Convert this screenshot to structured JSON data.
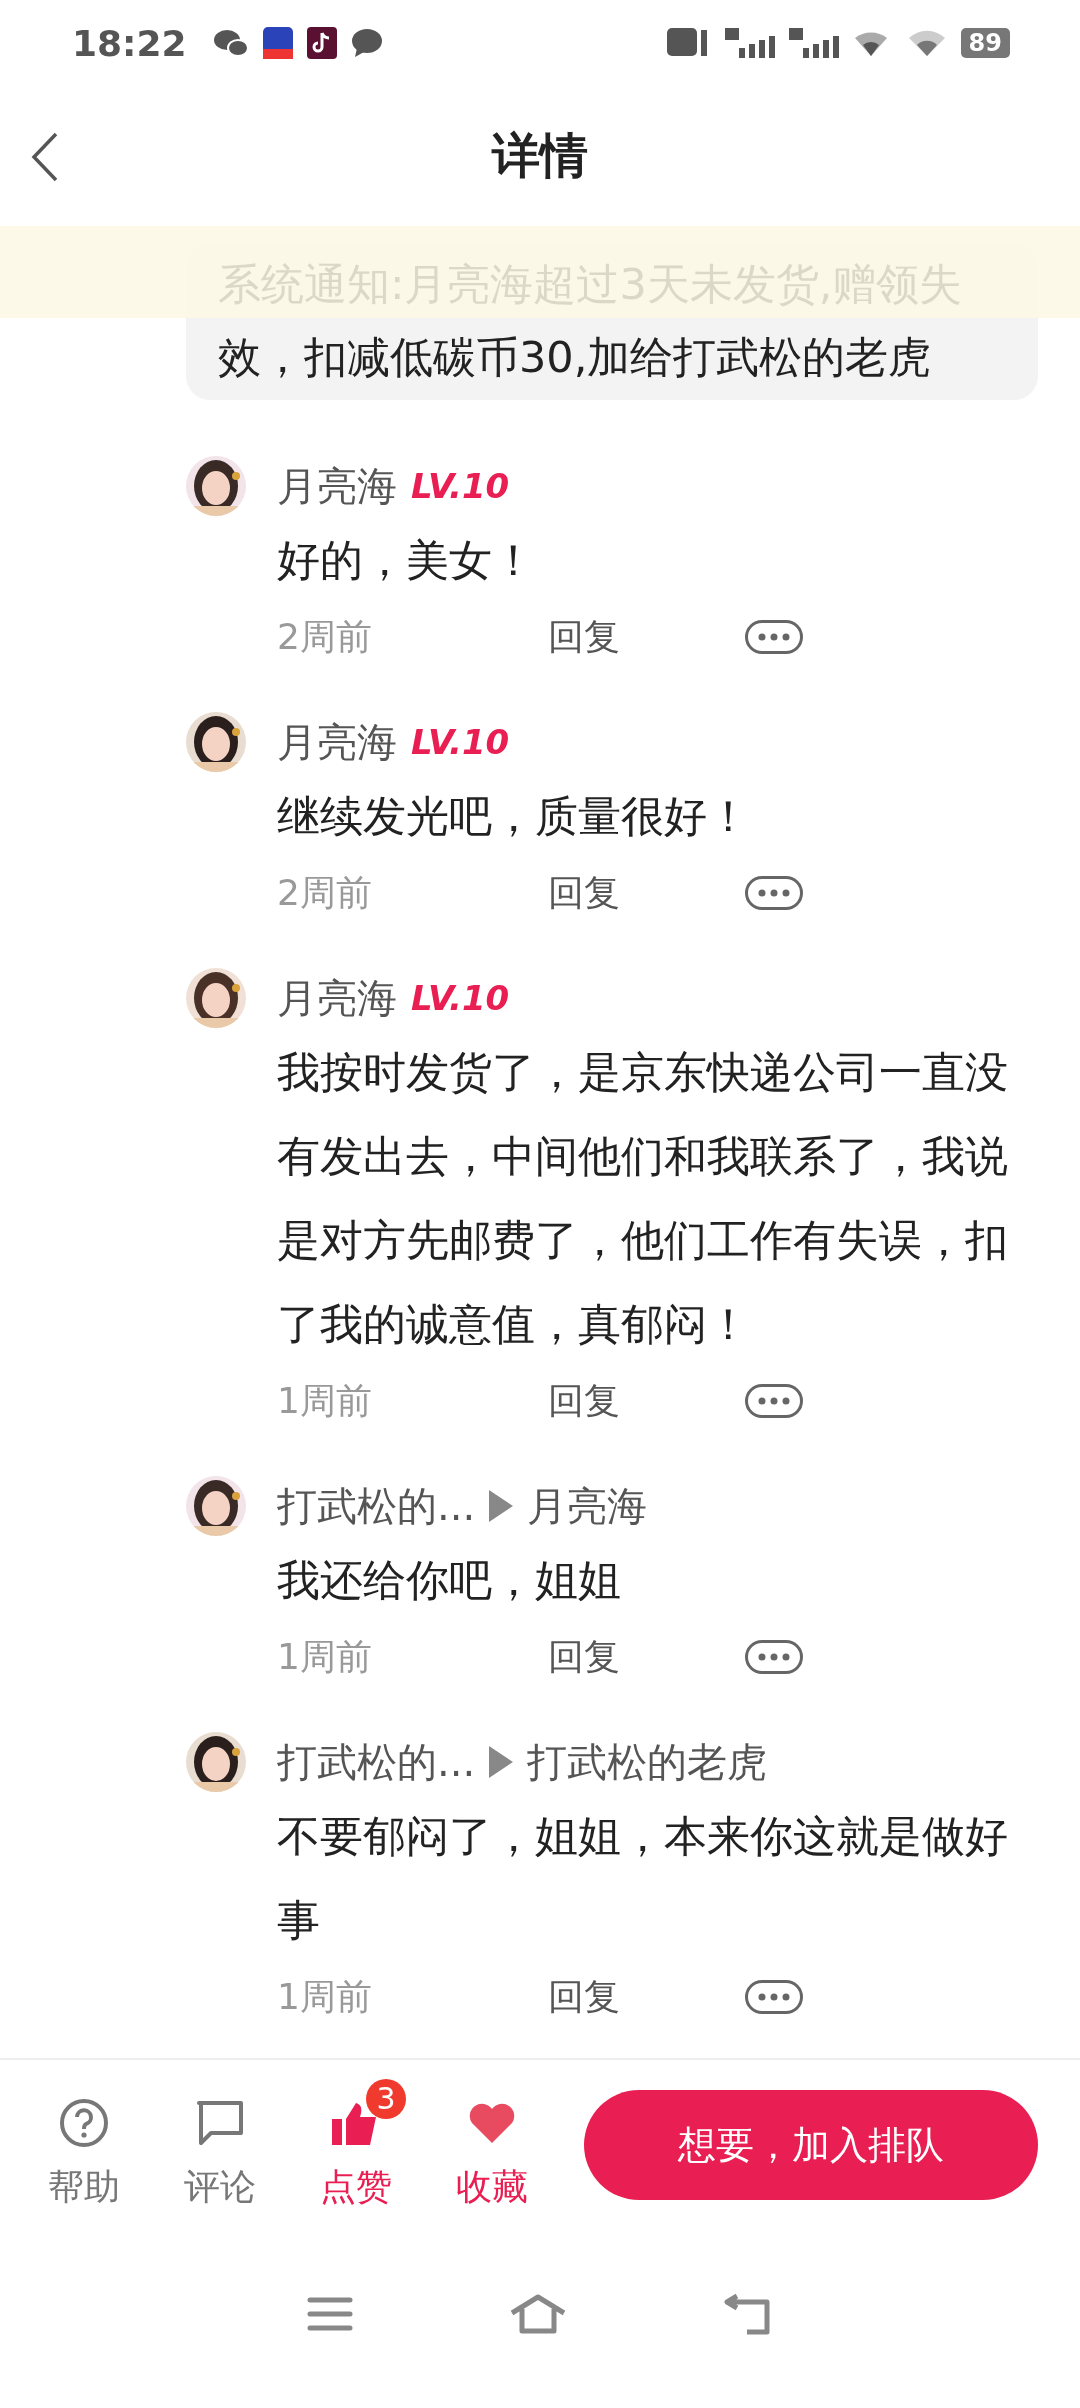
{
  "status_bar": {
    "time": "18:22",
    "battery": "89"
  },
  "header": {
    "title": "详情"
  },
  "notice": {
    "text": "系统通知:月亮海超过3天未发货,赠领失效，扣减低碳币30,加给打武松的老虎"
  },
  "comments": [
    {
      "kind": "comment",
      "author": "月亮海",
      "level_badge": "LV.10",
      "text": "好的，美女！",
      "time": "2周前",
      "reply": "回复"
    },
    {
      "kind": "comment",
      "author": "月亮海",
      "level_badge": "LV.10",
      "text": "继续发光吧，质量很好！",
      "time": "2周前",
      "reply": "回复"
    },
    {
      "kind": "comment",
      "author": "月亮海",
      "level_badge": "LV.10",
      "text": "我按时发货了，是京东快递公司一直没有发出去，中间他们和我联系了，我说是对方先邮费了，他们工作有失误，扣了我的诚意值，真郁闷！",
      "time": "1周前",
      "reply": "回复"
    },
    {
      "kind": "reply",
      "author": "打武松的...",
      "target": "月亮海",
      "text": "我还给你吧，姐姐",
      "time": "1周前",
      "reply": "回复"
    },
    {
      "kind": "reply",
      "author": "打武松的...",
      "target": "打武松的老虎",
      "text": "不要郁闷了，姐姐，本来你这就是做好事",
      "time": "1周前",
      "reply": "回复"
    }
  ],
  "actions": [
    {
      "kind": "help",
      "label": "帮助",
      "active": false
    },
    {
      "kind": "comment",
      "label": "评论",
      "active": false
    },
    {
      "kind": "like",
      "label": "点赞",
      "active": true,
      "badge": "3"
    },
    {
      "kind": "favorite",
      "label": "收藏",
      "active": true
    }
  ],
  "primary_button": {
    "label": "想要，加入排队"
  }
}
